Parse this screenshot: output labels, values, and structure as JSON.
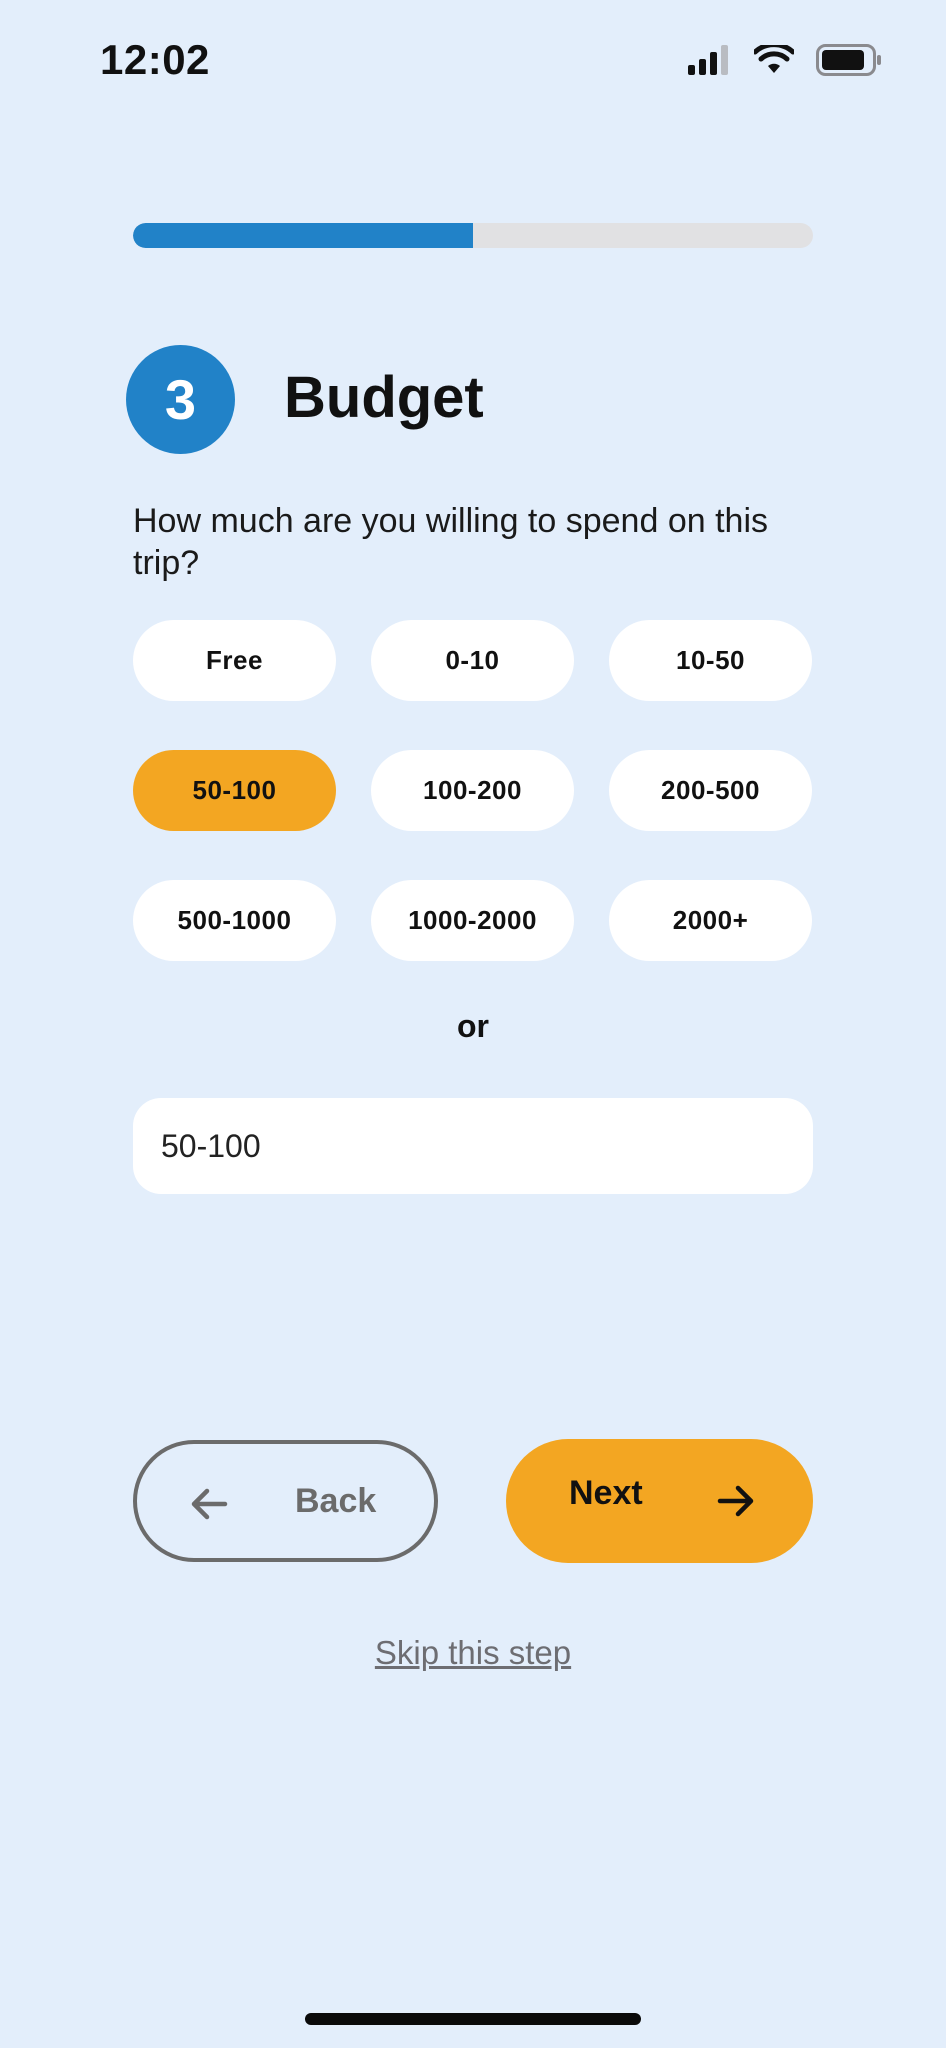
{
  "status_bar": {
    "time": "12:02",
    "icons": [
      "cellular-signal-icon",
      "wifi-icon",
      "battery-icon"
    ]
  },
  "progress": {
    "fraction": 0.5,
    "fill_color": "#2182c8",
    "track_color": "#e1e1e3"
  },
  "step": {
    "number": "3",
    "title": "Budget",
    "question": "How much are you willing to spend on this trip?"
  },
  "options": [
    {
      "label": "Free",
      "selected": false
    },
    {
      "label": "0-10",
      "selected": false
    },
    {
      "label": "10-50",
      "selected": false
    },
    {
      "label": "50-100",
      "selected": true
    },
    {
      "label": "100-200",
      "selected": false
    },
    {
      "label": "200-500",
      "selected": false
    },
    {
      "label": "500-1000",
      "selected": false
    },
    {
      "label": "1000-2000",
      "selected": false
    },
    {
      "label": "2000+",
      "selected": false
    }
  ],
  "or_label": "or",
  "custom_input": {
    "value": "50-100"
  },
  "navigation": {
    "back_label": "Back",
    "next_label": "Next",
    "skip_label": "Skip this step"
  },
  "colors": {
    "background": "#e3eefb",
    "accent_blue": "#2182c8",
    "accent_orange": "#f3a622"
  }
}
